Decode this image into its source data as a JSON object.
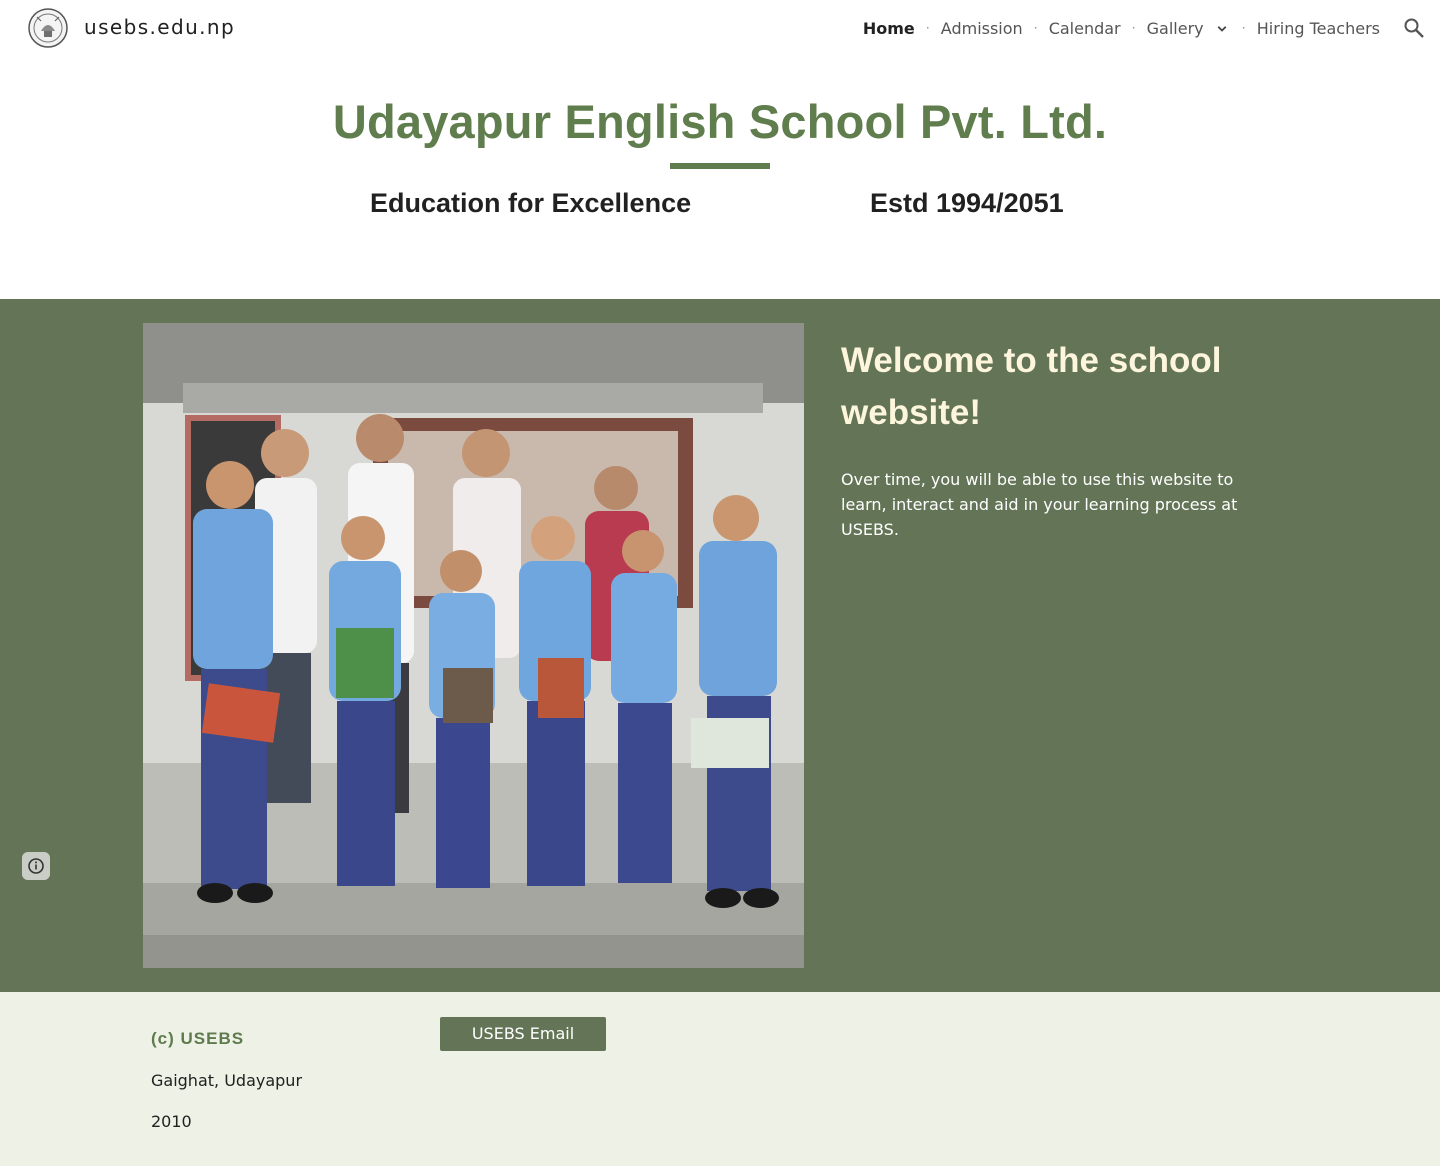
{
  "header": {
    "site_name": "usebs.edu.np",
    "nav": [
      {
        "label": "Home"
      },
      {
        "label": "Admission"
      },
      {
        "label": "Calendar"
      },
      {
        "label": "Gallery"
      },
      {
        "label": "Hiring Teachers"
      }
    ],
    "icons": [
      "school-logo-icon",
      "chevron-down-icon",
      "search-icon"
    ]
  },
  "hero": {
    "title": "Udayapur English School Pvt. Ltd.",
    "tagline": "Education for Excellence",
    "established": "Estd 1994/2051"
  },
  "welcome": {
    "heading": "Welcome to the school website!",
    "body": "Over time, you will be able to use this website to learn, interact and aid in your learning process at USEBS.",
    "icons": [
      "info-icon"
    ]
  },
  "footer": {
    "heading": "(c) USEBS",
    "address": "Gaighat, Udayapur",
    "year": "2010",
    "email_button": "USEBS Email"
  },
  "colors": {
    "accent_green": "#607d4e",
    "section_green": "#647557",
    "heading_cream": "#fdf6dc",
    "footer_bg": "#eef2e6"
  }
}
